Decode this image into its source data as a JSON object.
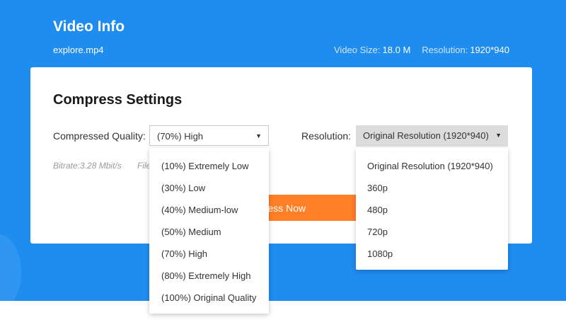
{
  "header": {
    "title": "Video Info",
    "file_name": "explore.mp4",
    "video_size_label": "Video Size:",
    "video_size_value": "18.0 M",
    "resolution_label": "Resolution:",
    "resolution_value": "1920*940"
  },
  "settings": {
    "title": "Compress Settings",
    "quality_label": "Compressed Quality:",
    "quality_selected": "(70%) High",
    "resolution_label": "Resolution:",
    "resolution_selected": "Original Resolution (1920*940)",
    "bitrate_text": "Bitrate:3.28 Mbit/s",
    "file_text_truncated": "File",
    "compress_button_visible_text": "press Now"
  },
  "quality_options": [
    "(10%) Extremely Low",
    "(30%) Low",
    "(40%) Medium-low",
    "(50%) Medium",
    "(70%) High",
    "(80%) Extremely High",
    "(100%) Original Quality"
  ],
  "resolution_options": [
    "Original Resolution (1920*940)",
    "360p",
    "480p",
    "720p",
    "1080p"
  ],
  "icons": {
    "dropdown_caret": "caret-down-icon"
  },
  "colors": {
    "hero_blue": "#1f8cf0",
    "button_orange": "#ff7f27",
    "card_white": "#ffffff"
  }
}
